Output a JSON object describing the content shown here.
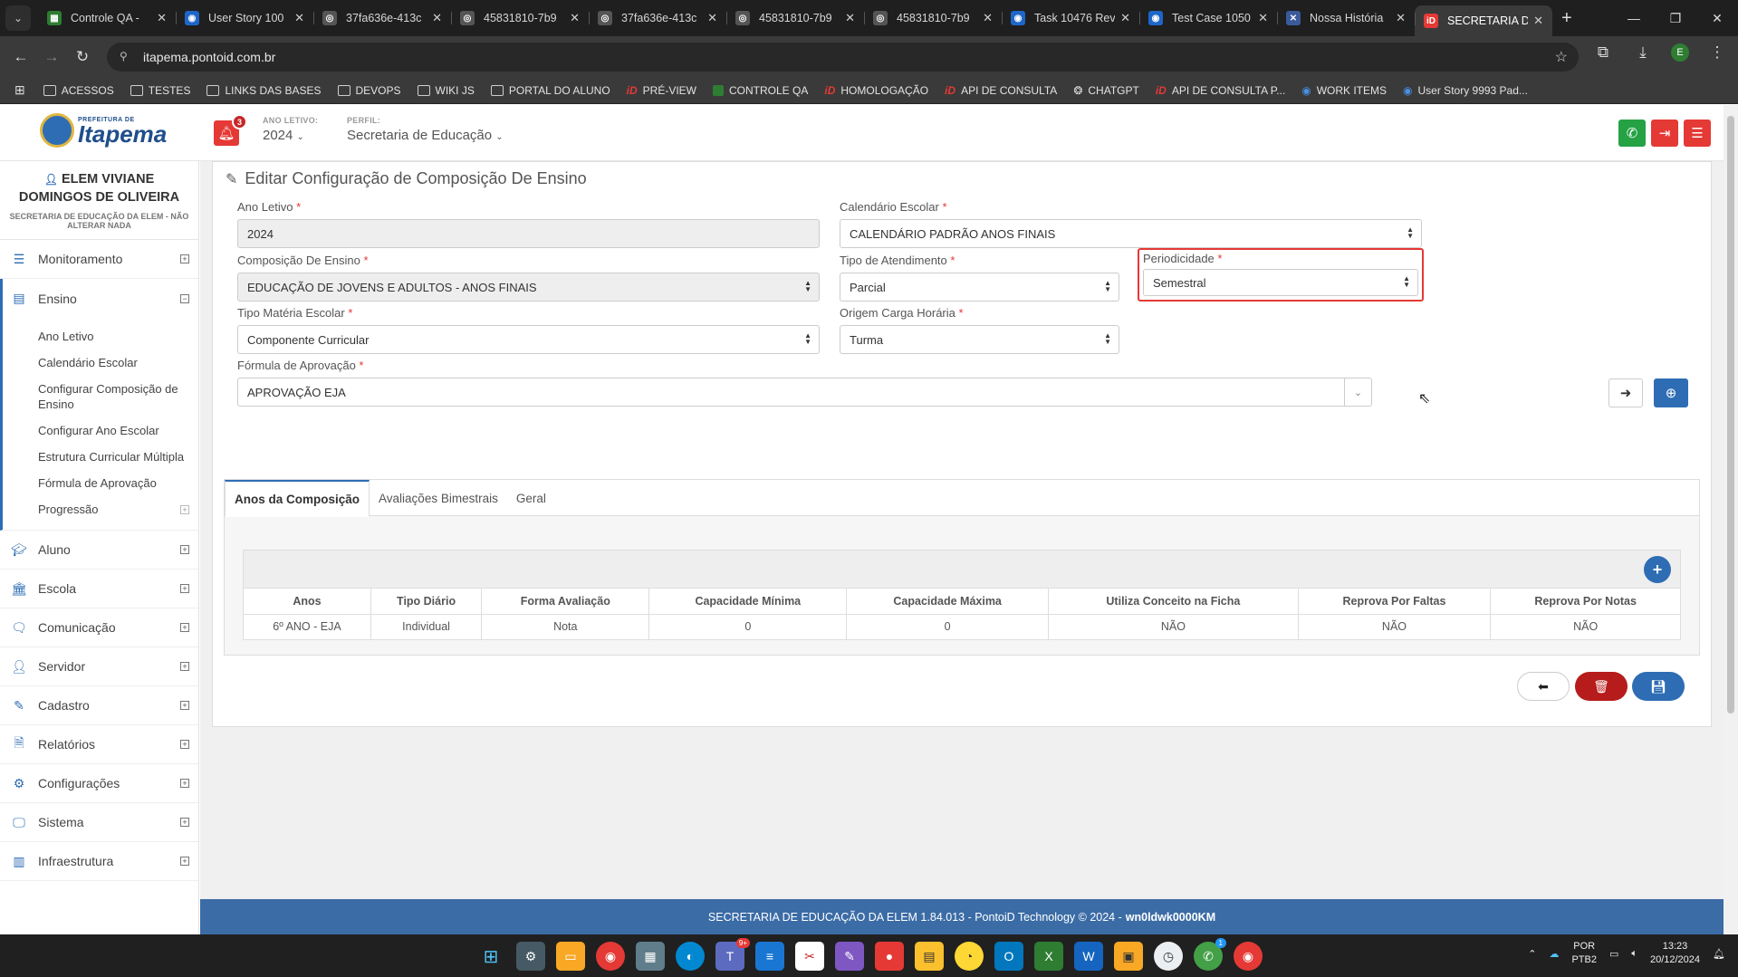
{
  "browser": {
    "tabs": [
      {
        "title": "Controle QA -",
        "color": "#2e7d32",
        "glyph": "▦"
      },
      {
        "title": "User Story 100",
        "color": "#1e66c8",
        "glyph": "◉"
      },
      {
        "title": "37fa636e-413c",
        "color": "#555555",
        "glyph": "◎"
      },
      {
        "title": "45831810-7b9",
        "color": "#555555",
        "glyph": "◎"
      },
      {
        "title": "37fa636e-413c",
        "color": "#555555",
        "glyph": "◎"
      },
      {
        "title": "45831810-7b9",
        "color": "#555555",
        "glyph": "◎"
      },
      {
        "title": "45831810-7b9",
        "color": "#555555",
        "glyph": "◎"
      },
      {
        "title": "Task 10476 Rev",
        "color": "#1e66c8",
        "glyph": "◉"
      },
      {
        "title": "Test Case 1050",
        "color": "#1e66c8",
        "glyph": "◉"
      },
      {
        "title": "Nossa História",
        "color": "#3a5a9c",
        "glyph": "✕"
      },
      {
        "title": "SECRETARIA DE",
        "color": "#e53935",
        "glyph": "iD",
        "active": true
      }
    ],
    "url": "itapema.pontoid.com.br",
    "bookmarks": [
      {
        "label": "ACESSOS",
        "icon": "folder"
      },
      {
        "label": "TESTES",
        "icon": "folder"
      },
      {
        "label": "LINKS DAS BASES",
        "icon": "folder"
      },
      {
        "label": "DEVOPS",
        "icon": "folder"
      },
      {
        "label": "WIKI JS",
        "icon": "folder"
      },
      {
        "label": "PORTAL DO ALUNO",
        "icon": "folder"
      },
      {
        "label": "PRÉ-VIEW",
        "icon": "pontoid"
      },
      {
        "label": "CONTROLE QA",
        "icon": "sheets"
      },
      {
        "label": "HOMOLOGAÇÃO",
        "icon": "pontoid"
      },
      {
        "label": "API DE CONSULTA",
        "icon": "pontoid"
      },
      {
        "label": "CHATGPT",
        "icon": "chatgpt"
      },
      {
        "label": "API DE CONSULTA P...",
        "icon": "pontoid"
      },
      {
        "label": "WORK ITEMS",
        "icon": "devops"
      },
      {
        "label": "User Story 9993 Pad...",
        "icon": "devops"
      }
    ]
  },
  "header": {
    "logo_top": "PREFEITURA DE",
    "logo_name": "Itapema",
    "notifications": "3",
    "ano_letivo_label": "ANO LETIVO:",
    "ano_letivo_value": "2024",
    "perfil_label": "PERFIL:",
    "perfil_value": "Secretaria de Educação"
  },
  "sidebar": {
    "user_name": "ELEM VIVIANE DOMINGOS DE OLIVEIRA",
    "user_org": "SECRETARIA DE EDUCAÇÃO DA ELEM - NÃO ALTERAR NADA",
    "items": [
      {
        "label": "Monitoramento",
        "icon": "sliders-icon"
      },
      {
        "label": "Ensino",
        "icon": "book-icon"
      },
      {
        "label": "Aluno",
        "icon": "graduation-cap-icon"
      },
      {
        "label": "Escola",
        "icon": "institution-icon"
      },
      {
        "label": "Comunicação",
        "icon": "comment-icon"
      },
      {
        "label": "Servidor",
        "icon": "user-icon"
      },
      {
        "label": "Cadastro",
        "icon": "edit-icon"
      },
      {
        "label": "Relatórios",
        "icon": "file-icon"
      },
      {
        "label": "Configurações",
        "icon": "cog-icon"
      },
      {
        "label": "Sistema",
        "icon": "desktop-icon"
      },
      {
        "label": "Infraestrutura",
        "icon": "building-icon"
      }
    ],
    "ensino_sub": [
      "Ano Letivo",
      "Calendário Escolar",
      "Configurar Composição de Ensino",
      "Configurar Ano Escolar",
      "Estrutura Curricular Múltipla",
      "Fórmula de Aprovação",
      "Progressão"
    ]
  },
  "form": {
    "title": "Editar Configuração de Composição De Ensino",
    "ano_letivo": {
      "label": "Ano Letivo",
      "value": "2024"
    },
    "calendario": {
      "label": "Calendário Escolar",
      "value": "CALENDÁRIO PADRÃO ANOS FINAIS"
    },
    "composicao": {
      "label": "Composição De Ensino",
      "value": "EDUCAÇÃO DE JOVENS E ADULTOS - ANOS FINAIS"
    },
    "tipo_atendimento": {
      "label": "Tipo de Atendimento",
      "value": "Parcial"
    },
    "periodicidade": {
      "label": "Periodicidade",
      "value": "Semestral"
    },
    "tipo_materia": {
      "label": "Tipo Matéria Escolar",
      "value": "Componente Curricular"
    },
    "origem_carga": {
      "label": "Origem Carga Horária",
      "value": "Turma"
    },
    "formula": {
      "label": "Fórmula de Aprovação",
      "value": "APROVAÇÃO EJA"
    }
  },
  "tabs": [
    "Anos da Composição",
    "Avaliações Bimestrais",
    "Geral"
  ],
  "table": {
    "columns": [
      "Anos",
      "Tipo Diário",
      "Forma Avaliação",
      "Capacidade Mínima",
      "Capacidade Máxima",
      "Utiliza Conceito na Ficha",
      "Reprova Por Faltas",
      "Reprova Por Notas"
    ],
    "rows": [
      [
        "6º ANO - EJA",
        "Individual",
        "Nota",
        "0",
        "0",
        "NÃO",
        "NÃO",
        "NÃO"
      ]
    ]
  },
  "footer": {
    "text": "SECRETARIA DE EDUCAÇÃO DA ELEM 1.84.013 - PontoiD Technology © 2024 -",
    "code": "wn0ldwk0000KM"
  },
  "taskbar": {
    "lang": "POR",
    "layout": "PTB2",
    "time": "13:23",
    "date": "20/12/2024",
    "teams_badge": "9+",
    "whatsapp_badge": "1"
  },
  "colors": {
    "primary": "#2e6db4",
    "danger": "#e53935",
    "dark_red": "#b71c1c",
    "whatsapp": "#25a244"
  }
}
